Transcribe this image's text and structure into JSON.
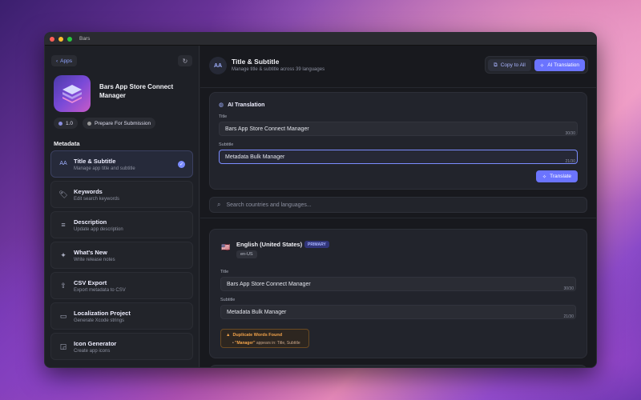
{
  "window": {
    "title": "Bars"
  },
  "sidebar": {
    "back_label": "Apps",
    "app_name": "Bars App Store Connect Manager",
    "version": "1.0",
    "status": "Prepare For Submission",
    "section_label": "Metadata",
    "items": [
      {
        "title": "Title & Subtitle",
        "subtitle": "Manage app title and subtitle",
        "icon": "text-size-icon",
        "active": true
      },
      {
        "title": "Keywords",
        "subtitle": "Edit search keywords",
        "icon": "tag-icon"
      },
      {
        "title": "Description",
        "subtitle": "Update app description",
        "icon": "text-lines-icon"
      },
      {
        "title": "What's New",
        "subtitle": "Write release notes",
        "icon": "sparkles-icon"
      },
      {
        "title": "CSV Export",
        "subtitle": "Export metadata to CSV",
        "icon": "share-icon"
      },
      {
        "title": "Localization Project",
        "subtitle": "Generate Xcode strings",
        "icon": "folder-icon"
      },
      {
        "title": "Icon Generator",
        "subtitle": "Create app icons",
        "icon": "app-icon-icon"
      }
    ]
  },
  "header": {
    "title": "Title & Subtitle",
    "subtitle": "Manage title & subtitle across 39 languages",
    "copy_all_label": "Copy to All",
    "ai_translation_label": "AI Translation"
  },
  "ai_card": {
    "heading": "AI Translation",
    "title_label": "Title",
    "title_value": "Bars App Store Connect Manager",
    "title_count": "30/30",
    "subtitle_label": "Subtitle",
    "subtitle_value": "Metadata Bulk Manager",
    "subtitle_count": "21/30",
    "translate_label": "Translate"
  },
  "search": {
    "placeholder": "Search countries and languages..."
  },
  "language": {
    "flag": "🇺🇸",
    "name": "English (United States)",
    "badge": "PRIMARY",
    "locale": "en-US",
    "title_label": "Title",
    "title_value": "Bars App Store Connect Manager",
    "title_count": "30/30",
    "subtitle_label": "Subtitle",
    "subtitle_value": "Metadata Bulk Manager",
    "subtitle_count": "21/30",
    "warning_title": "Duplicate Words Found",
    "warning_word": "\"Manager\"",
    "warning_text": "appears in: Title, Subtitle"
  },
  "colors": {
    "accent": "#6b74ff",
    "warning": "#f0a24a"
  }
}
